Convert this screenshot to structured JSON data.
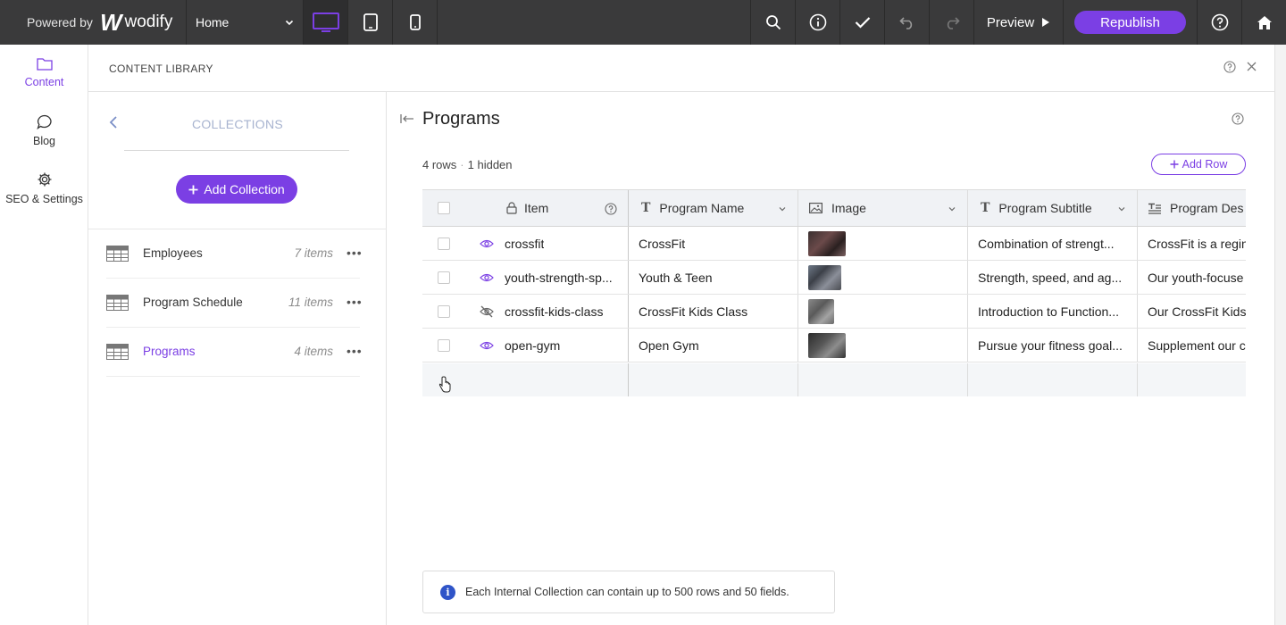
{
  "topbar": {
    "powered_by": "Powered by",
    "logo_mark": "W",
    "logo_text": "wodify",
    "page_select": "Home",
    "preview_label": "Preview",
    "republish_label": "Republish",
    "accent": "#7b3fe4"
  },
  "rail": {
    "items": [
      {
        "label": "Content",
        "icon": "folder-icon",
        "active": true
      },
      {
        "label": "Blog",
        "icon": "chat-bubble-icon",
        "active": false
      },
      {
        "label": "SEO & Settings",
        "icon": "gear-icon",
        "active": false
      }
    ]
  },
  "library": {
    "title": "CONTENT LIBRARY",
    "collections_heading": "COLLECTIONS",
    "add_collection_label": "Add Collection",
    "collections": [
      {
        "name": "Employees",
        "count": "7 items",
        "active": false
      },
      {
        "name": "Program Schedule",
        "count": "11 items",
        "active": false
      },
      {
        "name": "Programs",
        "count": "4 items",
        "active": true
      }
    ]
  },
  "main": {
    "title": "Programs",
    "rows_count": "4 rows",
    "hidden_count": "1 hidden",
    "add_row_label": "Add Row",
    "columns": [
      {
        "label": "Item",
        "icon": "lock-icon"
      },
      {
        "label": "Program Name",
        "icon": "text-type-icon"
      },
      {
        "label": "Image",
        "icon": "image-icon"
      },
      {
        "label": "Program Subtitle",
        "icon": "text-type-icon"
      },
      {
        "label": "Program Des",
        "icon": "rich-text-icon"
      }
    ],
    "rows": [
      {
        "item": "crossfit",
        "visible": true,
        "name": "CrossFit",
        "subtitle": "Combination of strengt...",
        "desc": "CrossFit is a regin"
      },
      {
        "item": "youth-strength-sp...",
        "visible": true,
        "name": "Youth & Teen",
        "subtitle": "Strength, speed, and ag...",
        "desc": "Our youth-focuse"
      },
      {
        "item": "crossfit-kids-class",
        "visible": false,
        "name": "CrossFit Kids Class",
        "subtitle": "Introduction to Function...",
        "desc": "Our CrossFit Kids"
      },
      {
        "item": "open-gym",
        "visible": true,
        "name": "Open Gym",
        "subtitle": "Pursue your fitness goal...",
        "desc": "Supplement our c"
      }
    ],
    "notice": "Each Internal Collection can contain up to 500 rows and 50 fields."
  }
}
